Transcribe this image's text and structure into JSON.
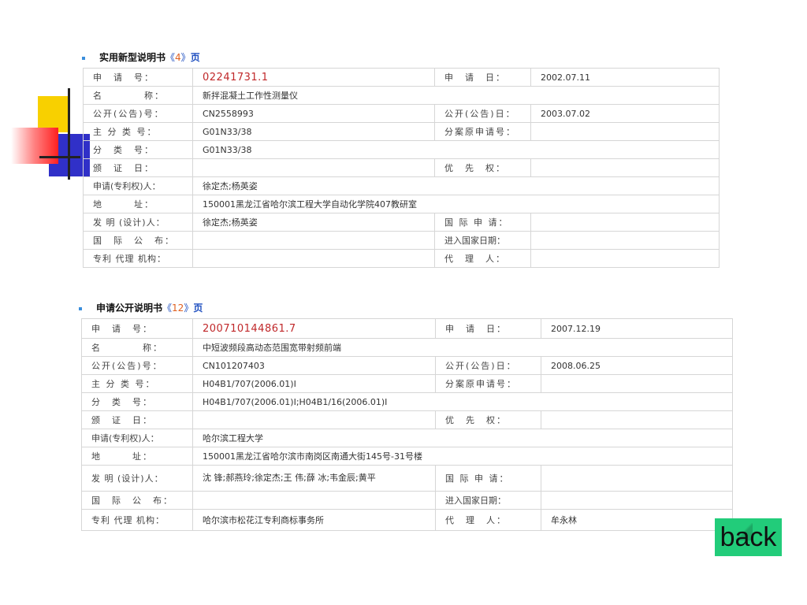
{
  "sections": [
    {
      "title": "实用新型说明书",
      "paren_open": "《",
      "page_num": "4",
      "paren_close": "》",
      "page_word": "页",
      "rows": {
        "app_no": {
          "label": "申　请　号：",
          "value": "02241731.1",
          "label2": "申　请　日：",
          "value2": "2002.07.11"
        },
        "name": {
          "label": "名　　　　称：",
          "value": "新拌混凝土工作性测量仪"
        },
        "pub_no": {
          "label": "公开(公告)号：",
          "value": "CN2558993",
          "label2": "公开(公告)日：",
          "value2": "2003.07.02"
        },
        "main_class": {
          "label": "主 分 类 号：",
          "value": "G01N33/38",
          "label2": "分案原申请号：",
          "value2": ""
        },
        "class": {
          "label": "分　类　号：",
          "value": "G01N33/38"
        },
        "grant_date": {
          "label": "颁　证　日：",
          "value": "",
          "label2": "优　先　权：",
          "value2": ""
        },
        "applicant": {
          "label": "申请(专利权)人：",
          "value": "徐定杰;杨英姿"
        },
        "address": {
          "label": "地　　　址：",
          "value": "150001黑龙江省哈尔滨工程大学自动化学院407教研室"
        },
        "inventor": {
          "label": "发 明 (设计)人：",
          "value": "徐定杰;杨英姿",
          "label2": "国 际 申 请：",
          "value2": ""
        },
        "intl_pub": {
          "label": "国　际　公　布：",
          "value": "",
          "label2": "进入国家日期：",
          "value2": ""
        },
        "agency": {
          "label": "专利 代理 机构：",
          "value": "",
          "label2": "代　理　人：",
          "value2": ""
        }
      }
    },
    {
      "title": "申请公开说明书",
      "paren_open": "《",
      "page_num": "12",
      "paren_close": "》",
      "page_word": "页",
      "rows": {
        "app_no": {
          "label": "申　请　号：",
          "value": "200710144861.7",
          "label2": "申　请　日：",
          "value2": "2007.12.19"
        },
        "name": {
          "label": "名　　　　称：",
          "value": "中短波频段高动态范围宽带射频前端"
        },
        "pub_no": {
          "label": "公开(公告)号：",
          "value": "CN101207403",
          "label2": "公开(公告)日：",
          "value2": "2008.06.25"
        },
        "main_class": {
          "label": "主 分 类 号：",
          "value": "H04B1/707(2006.01)I",
          "label2": "分案原申请号：",
          "value2": ""
        },
        "class": {
          "label": "分　类　号：",
          "value": "H04B1/707(2006.01)I;H04B1/16(2006.01)I"
        },
        "grant_date": {
          "label": "颁　证　日：",
          "value": "",
          "label2": "优　先　权：",
          "value2": ""
        },
        "applicant": {
          "label": "申请(专利权)人：",
          "value": "哈尔滨工程大学"
        },
        "address": {
          "label": "地　　　址：",
          "value": "150001黑龙江省哈尔滨市南岗区南通大街145号-31号楼"
        },
        "inventor": {
          "label": "发 明 (设计)人：",
          "value": "沈 锋;郝燕玲;徐定杰;王 伟;薛 冰;韦金辰;黄平",
          "label2": "国 际 申 请：",
          "value2": ""
        },
        "intl_pub": {
          "label": "国　际　公　布：",
          "value": "",
          "label2": "进入国家日期：",
          "value2": ""
        },
        "agency": {
          "label": "专利 代理 机构：",
          "value": "哈尔滨市松花江专利商标事务所",
          "label2": "代　理　人：",
          "value2": "牟永林"
        }
      }
    }
  ],
  "back_label": "back",
  "colors": {
    "accent_red": "#c0282a",
    "link_blue": "#2050c0",
    "page_orange": "#e06020",
    "back_green": "#22cc7a"
  }
}
